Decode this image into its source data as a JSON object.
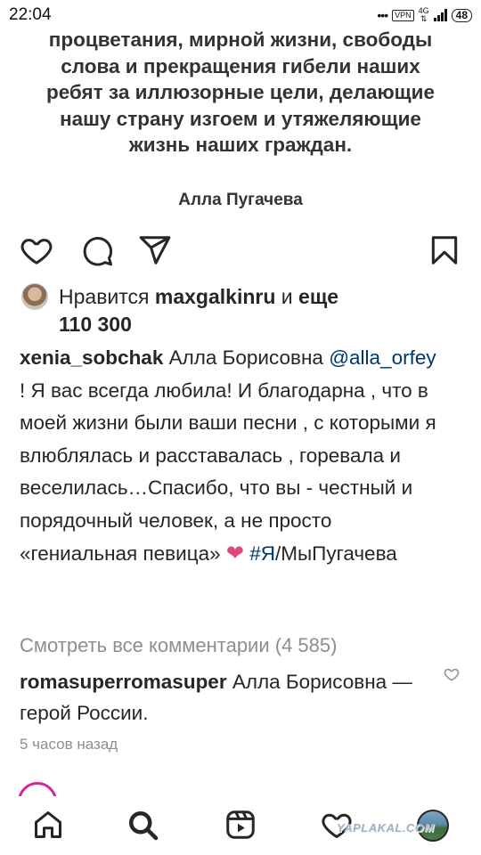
{
  "status_bar": {
    "time": "22:04",
    "dots": "•••",
    "vpn": "VPN",
    "network": "4G",
    "battery": "48"
  },
  "post_image": {
    "quote_lines": [
      "процветания, мирной жизни, свободы",
      "слова и прекращения гибели наших",
      "ребят за иллюзорные цели, делающие",
      "нашу страну изгоем и утяжеляющие",
      "жизнь наших граждан."
    ],
    "author": "Алла Пугачева"
  },
  "actions": {
    "icons": [
      "heart-icon",
      "comment-icon",
      "share-icon",
      "bookmark-icon"
    ]
  },
  "likes": {
    "prefix": "Нравится",
    "user": "maxgalkinru",
    "conj": "и",
    "more": "еще",
    "count": "110 300"
  },
  "caption": {
    "user": "xenia_sobchak",
    "text1": "Алла Борисовна",
    "mention": "@alla_orfey",
    "text2": "! Я вас всегда любила! И благодарна , что в моей жизни были ваши песни , с которыми я влюблялась и расставалась , горевала и веселилась…Спасибо, что вы - честный и порядочный человек, а не просто «гениальная певица»",
    "emoji": "❤",
    "hashtag": "#Я",
    "text3": "/МыПугачева"
  },
  "view_comments": "Смотреть все комментарии (4 585)",
  "comment": {
    "user": "romasuperromasuper",
    "text": "Алла Борисовна — герой России."
  },
  "timestamp": "5 часов назад",
  "watermark": "YAPLAKAL.COM",
  "nav": [
    "home-icon",
    "search-icon",
    "reels-icon",
    "activity-icon",
    "profile-avatar"
  ],
  "colors": {
    "text": "#262626",
    "secondary": "#8e8e8e",
    "link": "#00376b",
    "heart": "#e0457b"
  }
}
